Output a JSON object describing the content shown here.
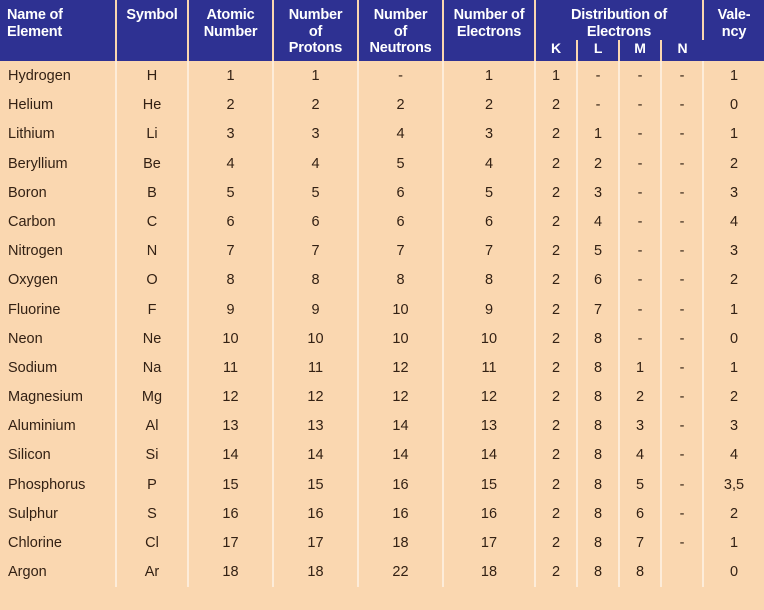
{
  "table": {
    "headers": {
      "name": "Name of\nElement",
      "name_line1": "Name of",
      "name_line2": "Element",
      "symbol": "Symbol",
      "atomic_number_line1": "Atomic",
      "atomic_number_line2": "Number",
      "protons_line1": "Number",
      "protons_line2": "of",
      "protons_line3": "Protons",
      "neutrons_line1": "Number",
      "neutrons_line2": "of",
      "neutrons_line3": "Neutrons",
      "electrons_line1": "Number of",
      "electrons_line2": "Electrons",
      "distribution_line1": "Distribution of",
      "distribution_line2": "Electrons",
      "valency_line1": "Vale-",
      "valency_line2": "ncy",
      "shell_K": "K",
      "shell_L": "L",
      "shell_M": "M",
      "shell_N": "N"
    },
    "colors": {
      "header_background": "#2e3192",
      "header_text": "#ffffff",
      "body_background": "#fad7b0",
      "body_text": "#332114",
      "divider": "#fdecd9"
    },
    "rows": [
      {
        "name": "Hydrogen",
        "symbol": "H",
        "atomic_number": "1",
        "protons": "1",
        "neutrons": "-",
        "electrons": "1",
        "K": "1",
        "L": "-",
        "M": "-",
        "N": "-",
        "valency": "1"
      },
      {
        "name": "Helium",
        "symbol": "He",
        "atomic_number": "2",
        "protons": "2",
        "neutrons": "2",
        "electrons": "2",
        "K": "2",
        "L": "-",
        "M": "-",
        "N": "-",
        "valency": "0"
      },
      {
        "name": "Lithium",
        "symbol": "Li",
        "atomic_number": "3",
        "protons": "3",
        "neutrons": "4",
        "electrons": "3",
        "K": "2",
        "L": "1",
        "M": "-",
        "N": "-",
        "valency": "1"
      },
      {
        "name": "Beryllium",
        "symbol": "Be",
        "atomic_number": "4",
        "protons": "4",
        "neutrons": "5",
        "electrons": "4",
        "K": "2",
        "L": "2",
        "M": "-",
        "N": "-",
        "valency": "2"
      },
      {
        "name": "Boron",
        "symbol": "B",
        "atomic_number": "5",
        "protons": "5",
        "neutrons": "6",
        "electrons": "5",
        "K": "2",
        "L": "3",
        "M": "-",
        "N": "-",
        "valency": "3"
      },
      {
        "name": "Carbon",
        "symbol": "C",
        "atomic_number": "6",
        "protons": "6",
        "neutrons": "6",
        "electrons": "6",
        "K": "2",
        "L": "4",
        "M": "-",
        "N": "-",
        "valency": "4"
      },
      {
        "name": "Nitrogen",
        "symbol": "N",
        "atomic_number": "7",
        "protons": "7",
        "neutrons": "7",
        "electrons": "7",
        "K": "2",
        "L": "5",
        "M": "-",
        "N": "-",
        "valency": "3"
      },
      {
        "name": "Oxygen",
        "symbol": "O",
        "atomic_number": "8",
        "protons": "8",
        "neutrons": "8",
        "electrons": "8",
        "K": "2",
        "L": "6",
        "M": "-",
        "N": "-",
        "valency": "2"
      },
      {
        "name": "Fluorine",
        "symbol": "F",
        "atomic_number": "9",
        "protons": "9",
        "neutrons": "10",
        "electrons": "9",
        "K": "2",
        "L": "7",
        "M": "-",
        "N": "-",
        "valency": "1"
      },
      {
        "name": "Neon",
        "symbol": "Ne",
        "atomic_number": "10",
        "protons": "10",
        "neutrons": "10",
        "electrons": "10",
        "K": "2",
        "L": "8",
        "M": "-",
        "N": "-",
        "valency": "0"
      },
      {
        "name": "Sodium",
        "symbol": "Na",
        "atomic_number": "11",
        "protons": "11",
        "neutrons": "12",
        "electrons": "11",
        "K": "2",
        "L": "8",
        "M": "1",
        "N": "-",
        "valency": "1"
      },
      {
        "name": "Magnesium",
        "symbol": "Mg",
        "atomic_number": "12",
        "protons": "12",
        "neutrons": "12",
        "electrons": "12",
        "K": "2",
        "L": "8",
        "M": "2",
        "N": "-",
        "valency": "2"
      },
      {
        "name": "Aluminium",
        "symbol": "Al",
        "atomic_number": "13",
        "protons": "13",
        "neutrons": "14",
        "electrons": "13",
        "K": "2",
        "L": "8",
        "M": "3",
        "N": "-",
        "valency": "3"
      },
      {
        "name": "Silicon",
        "symbol": "Si",
        "atomic_number": "14",
        "protons": "14",
        "neutrons": "14",
        "electrons": "14",
        "K": "2",
        "L": "8",
        "M": "4",
        "N": "-",
        "valency": "4"
      },
      {
        "name": "Phosphorus",
        "symbol": "P",
        "atomic_number": "15",
        "protons": "15",
        "neutrons": "16",
        "electrons": "15",
        "K": "2",
        "L": "8",
        "M": "5",
        "N": "-",
        "valency": "3,5"
      },
      {
        "name": "Sulphur",
        "symbol": "S",
        "atomic_number": "16",
        "protons": "16",
        "neutrons": "16",
        "electrons": "16",
        "K": "2",
        "L": "8",
        "M": "6",
        "N": "-",
        "valency": "2"
      },
      {
        "name": "Chlorine",
        "symbol": "Cl",
        "atomic_number": "17",
        "protons": "17",
        "neutrons": "18",
        "electrons": "17",
        "K": "2",
        "L": "8",
        "M": "7",
        "N": "-",
        "valency": "1"
      },
      {
        "name": "Argon",
        "symbol": "Ar",
        "atomic_number": "18",
        "protons": "18",
        "neutrons": "22",
        "electrons": "18",
        "K": "2",
        "L": "8",
        "M": "8",
        "N": "",
        "valency": "0"
      }
    ]
  }
}
